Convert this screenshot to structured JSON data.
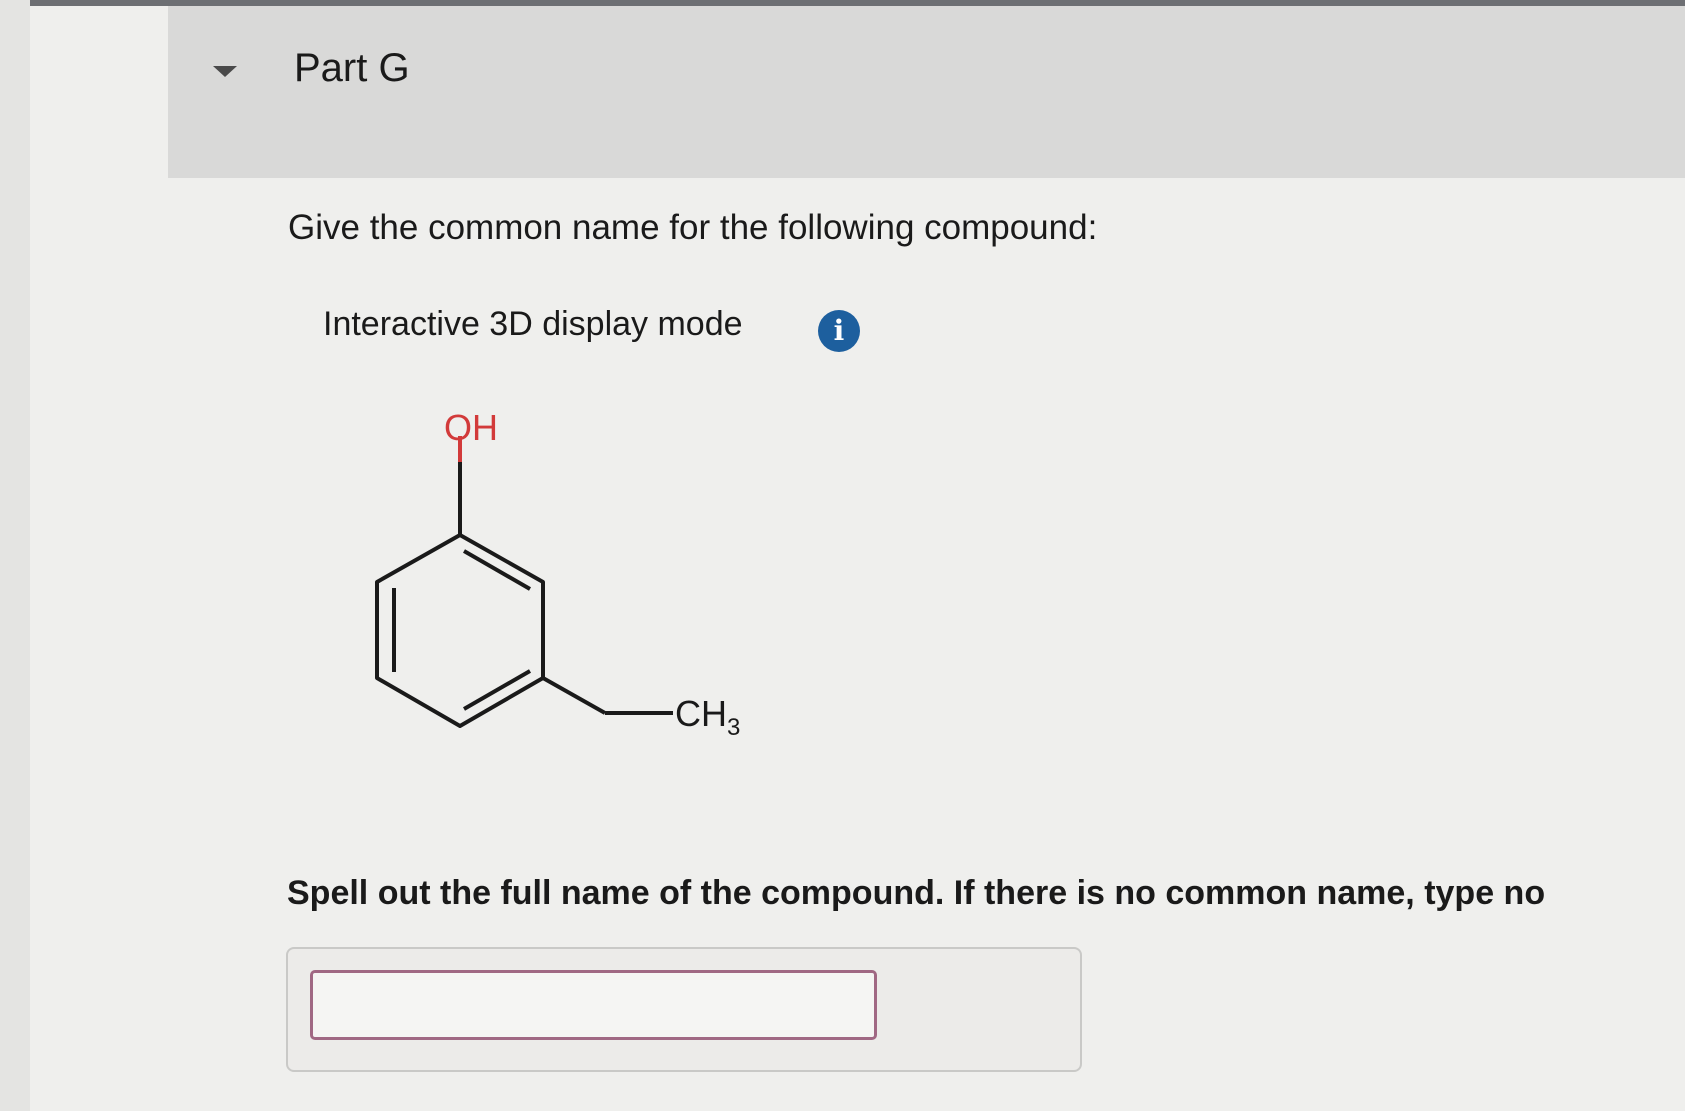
{
  "part": {
    "title": "Part G"
  },
  "question": {
    "prompt": "Give the common name for the following compound:"
  },
  "display": {
    "mode_label": "Interactive 3D display mode",
    "info_icon": "info-icon"
  },
  "molecule": {
    "hydroxyl": {
      "main": "OH"
    },
    "methyl": {
      "main": "CH",
      "subscript": "3"
    },
    "bond_color": "#1a1a1a",
    "oxygen_color": "#d23a3a"
  },
  "answer": {
    "instruction": "Spell out the full name of the compound. If there is no common name, type no",
    "value": ""
  },
  "colors": {
    "accent": "#1d5f9e",
    "input_border": "#a06883"
  }
}
